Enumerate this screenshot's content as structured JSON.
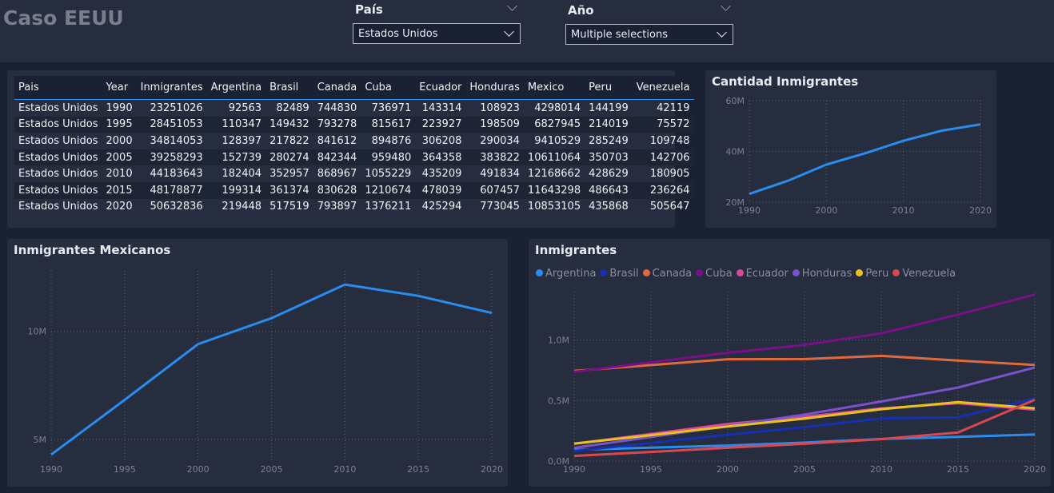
{
  "header": {
    "title": "Caso EEUU",
    "filters": [
      {
        "label": "País",
        "value": "Estados Unidos"
      },
      {
        "label": "Año",
        "value": "Multiple selections"
      }
    ]
  },
  "table": {
    "columns": [
      "Pais",
      "Year",
      "Inmigrantes",
      "Argentina",
      "Brasil",
      "Canada",
      "Cuba",
      "Ecuador",
      "Honduras",
      "Mexico",
      "Peru",
      "Venezuela"
    ],
    "rows": [
      [
        "Estados Unidos",
        "1990",
        "23251026",
        "92563",
        "82489",
        "744830",
        "736971",
        "143314",
        "108923",
        "4298014",
        "144199",
        "42119"
      ],
      [
        "Estados Unidos",
        "1995",
        "28451053",
        "110347",
        "149432",
        "793278",
        "815617",
        "223927",
        "198509",
        "6827945",
        "214019",
        "75572"
      ],
      [
        "Estados Unidos",
        "2000",
        "34814053",
        "128397",
        "217822",
        "841612",
        "894876",
        "306208",
        "290034",
        "9410529",
        "285249",
        "109748"
      ],
      [
        "Estados Unidos",
        "2005",
        "39258293",
        "152739",
        "280274",
        "842344",
        "959480",
        "364358",
        "383822",
        "10611064",
        "350703",
        "142706"
      ],
      [
        "Estados Unidos",
        "2010",
        "44183643",
        "182404",
        "352957",
        "868967",
        "1055229",
        "435209",
        "491834",
        "12168662",
        "428629",
        "180905"
      ],
      [
        "Estados Unidos",
        "2015",
        "48178877",
        "199314",
        "361374",
        "830628",
        "1210674",
        "478039",
        "607457",
        "11643298",
        "486643",
        "236264"
      ],
      [
        "Estados Unidos",
        "2020",
        "50632836",
        "219448",
        "517519",
        "793897",
        "1376211",
        "425294",
        "773045",
        "10853105",
        "435868",
        "505647"
      ]
    ]
  },
  "chart_data": [
    {
      "type": "line",
      "title": "Cantidad Inmigrantes",
      "x": [
        1990,
        1995,
        2000,
        2005,
        2010,
        2015,
        2020
      ],
      "series": [
        {
          "values": [
            23251026,
            28451053,
            34814053,
            39258293,
            44183643,
            48178877,
            50632836
          ],
          "color": "#2b8cf0"
        }
      ],
      "ylim": [
        20000000,
        60000000
      ],
      "yticks": [
        {
          "v": 20000000,
          "label": "20M"
        },
        {
          "v": 40000000,
          "label": "40M"
        },
        {
          "v": 60000000,
          "label": "60M"
        }
      ],
      "xticks": [
        "1990",
        "2000",
        "2010",
        "2020"
      ],
      "xtick_values": [
        1990,
        2000,
        2010,
        2020
      ],
      "grid": true
    },
    {
      "type": "line",
      "title": "Inmigrantes Mexicanos",
      "x": [
        1990,
        1995,
        2000,
        2005,
        2010,
        2015,
        2020
      ],
      "series": [
        {
          "values": [
            4298014,
            6827945,
            9410529,
            10611064,
            12168662,
            11643298,
            10853105
          ],
          "color": "#2b8cf0"
        }
      ],
      "ylim": [
        4000000,
        12800000
      ],
      "yticks": [
        {
          "v": 5000000,
          "label": "5M"
        },
        {
          "v": 10000000,
          "label": "10M"
        }
      ],
      "xticks": [
        "1990",
        "1995",
        "2000",
        "2005",
        "2010",
        "2015",
        "2020"
      ],
      "xtick_values": [
        1990,
        1995,
        2000,
        2005,
        2010,
        2015,
        2020
      ],
      "grid": true
    },
    {
      "type": "line",
      "title": "Inmigrantes",
      "legend": "top-left",
      "x": [
        1990,
        1995,
        2000,
        2005,
        2010,
        2015,
        2020
      ],
      "series": [
        {
          "name": "Argentina",
          "color": "#2b8cf0",
          "values": [
            92563,
            110347,
            128397,
            152739,
            182404,
            199314,
            219448
          ]
        },
        {
          "name": "Brasil",
          "color": "#1530b0",
          "values": [
            82489,
            149432,
            217822,
            280274,
            352957,
            361374,
            517519
          ]
        },
        {
          "name": "Canada",
          "color": "#e06a3b",
          "values": [
            744830,
            793278,
            841612,
            842344,
            868967,
            830628,
            793897
          ]
        },
        {
          "name": "Cuba",
          "color": "#7a0f8a",
          "values": [
            736971,
            815617,
            894876,
            959480,
            1055229,
            1210674,
            1376211
          ]
        },
        {
          "name": "Ecuador",
          "color": "#e045a0",
          "values": [
            143314,
            223927,
            306208,
            364358,
            435209,
            478039,
            425294
          ]
        },
        {
          "name": "Honduras",
          "color": "#7a52cc",
          "values": [
            108923,
            198509,
            290034,
            383822,
            491834,
            607457,
            773045
          ]
        },
        {
          "name": "Peru",
          "color": "#e8c31a",
          "values": [
            144199,
            214019,
            285249,
            350703,
            428629,
            486643,
            435868
          ]
        },
        {
          "name": "Venezuela",
          "color": "#d9484f",
          "values": [
            42119,
            75572,
            109748,
            142706,
            180905,
            236264,
            505647
          ]
        }
      ],
      "ylim": [
        0,
        1400000
      ],
      "yticks": [
        {
          "v": 0,
          "label": "0,0M"
        },
        {
          "v": 500000,
          "label": "0,5M"
        },
        {
          "v": 1000000,
          "label": "1,0M"
        }
      ],
      "xticks": [
        "1990",
        "1995",
        "2000",
        "2005",
        "2010",
        "2015",
        "2020"
      ],
      "xtick_values": [
        1990,
        1995,
        2000,
        2005,
        2010,
        2015,
        2020
      ],
      "grid": true
    }
  ]
}
